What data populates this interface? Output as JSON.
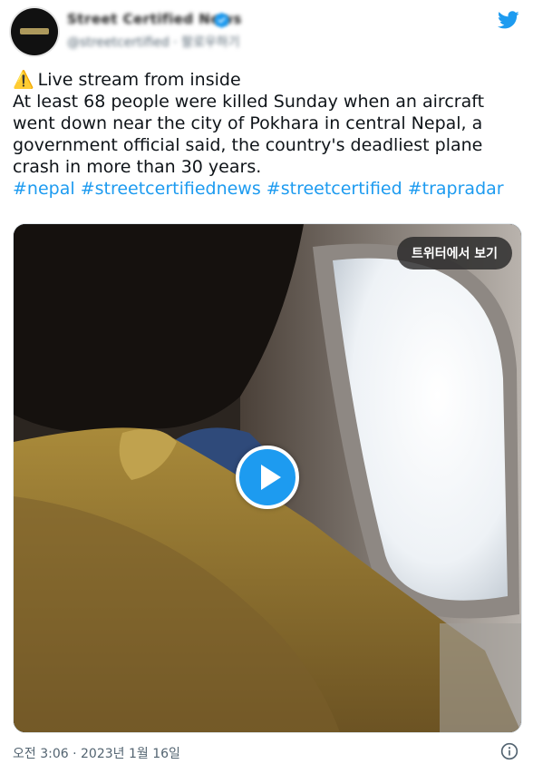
{
  "header": {
    "display_name": "Street Certified News",
    "handle": "@streetcertified · 팔로우하기"
  },
  "tweet": {
    "warning_emoji": "⚠️",
    "line1": "Live stream from inside",
    "line2": "At least 68 people were killed Sunday when an aircraft",
    "line3": "went down near the city of Pokhara in central Nepal, a",
    "line4": "government official said, the country's deadliest plane",
    "line5": "crash in more than 30 years.",
    "hashtags": [
      "#nepal",
      "#streetcertifiednews",
      "#streetcertified",
      "#trapradar"
    ]
  },
  "media": {
    "view_on_twitter_label": "트위터에서 보기",
    "play_icon": "play-icon"
  },
  "footer": {
    "timestamp": "오전 3:06 · 2023년 1월 16일",
    "info_icon": "info-icon"
  },
  "colors": {
    "link": "#1d9bf0",
    "text": "#0f1419",
    "muted": "#536471"
  }
}
